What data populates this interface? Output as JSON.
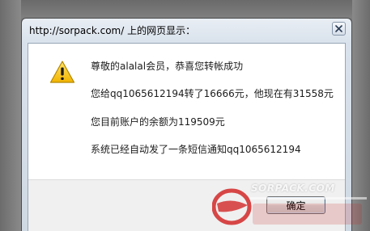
{
  "dialog": {
    "title": "http://sorpack.com/ 上的网页显示：",
    "icon": "warning-icon",
    "messages": [
      "尊敬的alalal会员，恭喜您转帐成功",
      "您给qq1065612194转了16666元，他现在有31558元",
      "您目前账户的余额为119509元",
      "系统已经自动发了一条短信通知qq1065612194"
    ],
    "ok_label": "确定"
  },
  "watermark": {
    "text": "SORPACK.COM"
  },
  "colors": {
    "warning_fill": "#f5c400",
    "warning_border": "#b38600",
    "watermark_red": "#d42a2a"
  }
}
